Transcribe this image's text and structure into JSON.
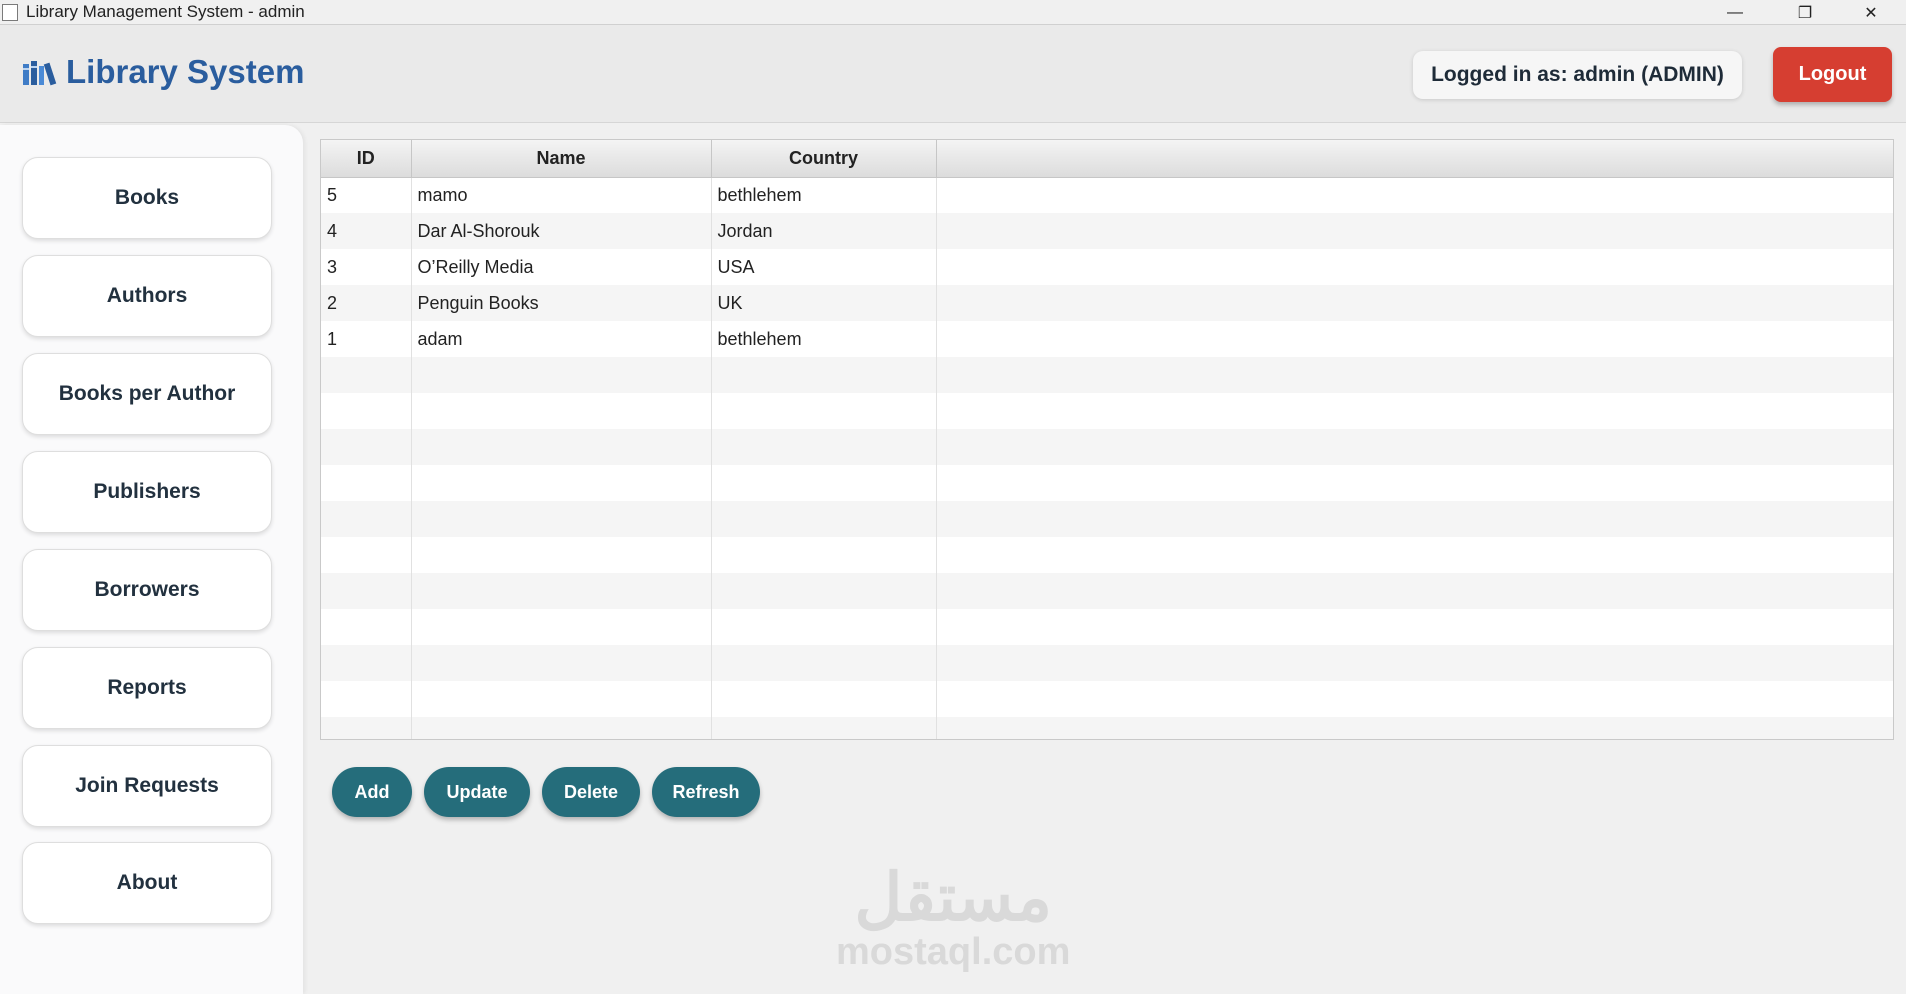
{
  "window": {
    "title": "Library Management System - admin",
    "minimize_glyph": "—",
    "maximize_glyph": "❐",
    "close_glyph": "✕"
  },
  "header": {
    "brand_title": "Library System",
    "brand_icon": "books-icon",
    "logged_in_text": "Logged in as: admin (ADMIN)",
    "logout_label": "Logout",
    "logout_color": "#d63e31",
    "brand_color": "#2a5d9e"
  },
  "sidebar": {
    "items": [
      {
        "label": "Books"
      },
      {
        "label": "Authors"
      },
      {
        "label": "Books per Author"
      },
      {
        "label": "Publishers"
      },
      {
        "label": "Borrowers"
      },
      {
        "label": "Reports"
      },
      {
        "label": "Join Requests"
      },
      {
        "label": "About"
      }
    ]
  },
  "table": {
    "columns": [
      "ID",
      "Name",
      "Country",
      ""
    ],
    "rows": [
      [
        "5",
        "mamo",
        "bethlehem"
      ],
      [
        "4",
        "Dar Al-Shorouk",
        "Jordan"
      ],
      [
        "3",
        "O’Reilly Media",
        "USA"
      ],
      [
        "2",
        "Penguin Books",
        "UK"
      ],
      [
        "1",
        "adam",
        "bethlehem"
      ]
    ]
  },
  "actions": {
    "color": "#256d7b",
    "buttons": [
      {
        "label": "Add"
      },
      {
        "label": "Update"
      },
      {
        "label": "Delete"
      },
      {
        "label": "Refresh"
      }
    ]
  },
  "watermark": {
    "arabic": "مستقل",
    "latin": "mostaql.com"
  }
}
